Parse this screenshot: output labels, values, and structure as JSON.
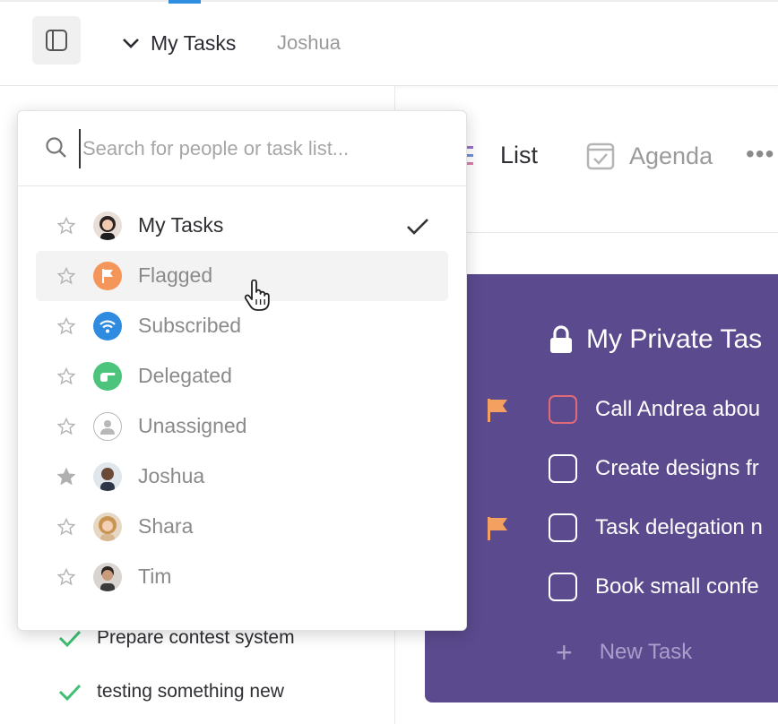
{
  "header": {
    "breadcrumb_main": "My Tasks",
    "breadcrumb_user": "Joshua"
  },
  "view_tabs": {
    "list": "List",
    "agenda": "Agenda",
    "more": "•••"
  },
  "completed_tasks": [
    {
      "label": "Prepare contest system"
    },
    {
      "label": "testing something new"
    }
  ],
  "card": {
    "title": "My Private Tas",
    "background": "#5b4a8e",
    "tasks": [
      {
        "label": "Call Andrea abou",
        "flagged": true,
        "urgent": true
      },
      {
        "label": "Create designs fr",
        "flagged": false,
        "urgent": false
      },
      {
        "label": "Task delegation n",
        "flagged": true,
        "urgent": false
      },
      {
        "label": "Book small confe",
        "flagged": false,
        "urgent": false
      }
    ],
    "new_task_label": "New Task"
  },
  "dropdown": {
    "search_placeholder": "Search for people or task list...",
    "items": [
      {
        "label": "My Tasks",
        "icon": "user-avatar-woman",
        "starred": false,
        "selected": true
      },
      {
        "label": "Flagged",
        "icon": "flag-icon",
        "starred": false,
        "selected": false
      },
      {
        "label": "Subscribed",
        "icon": "wifi-icon",
        "starred": false,
        "selected": false
      },
      {
        "label": "Delegated",
        "icon": "hand-pointing-icon",
        "starred": false,
        "selected": false
      },
      {
        "label": "Unassigned",
        "icon": "user-outline-icon",
        "starred": false,
        "selected": false
      },
      {
        "label": "Joshua",
        "icon": "user-avatar-joshua",
        "starred": true,
        "selected": false
      },
      {
        "label": "Shara",
        "icon": "user-avatar-shara",
        "starred": false,
        "selected": false
      },
      {
        "label": "Tim",
        "icon": "user-avatar-tim",
        "starred": false,
        "selected": false
      }
    ]
  },
  "colors": {
    "accent_blue": "#2f8ee0",
    "flag_orange": "#f4a060",
    "check_green": "#3fbf73",
    "urgent_red": "#e0697a"
  }
}
